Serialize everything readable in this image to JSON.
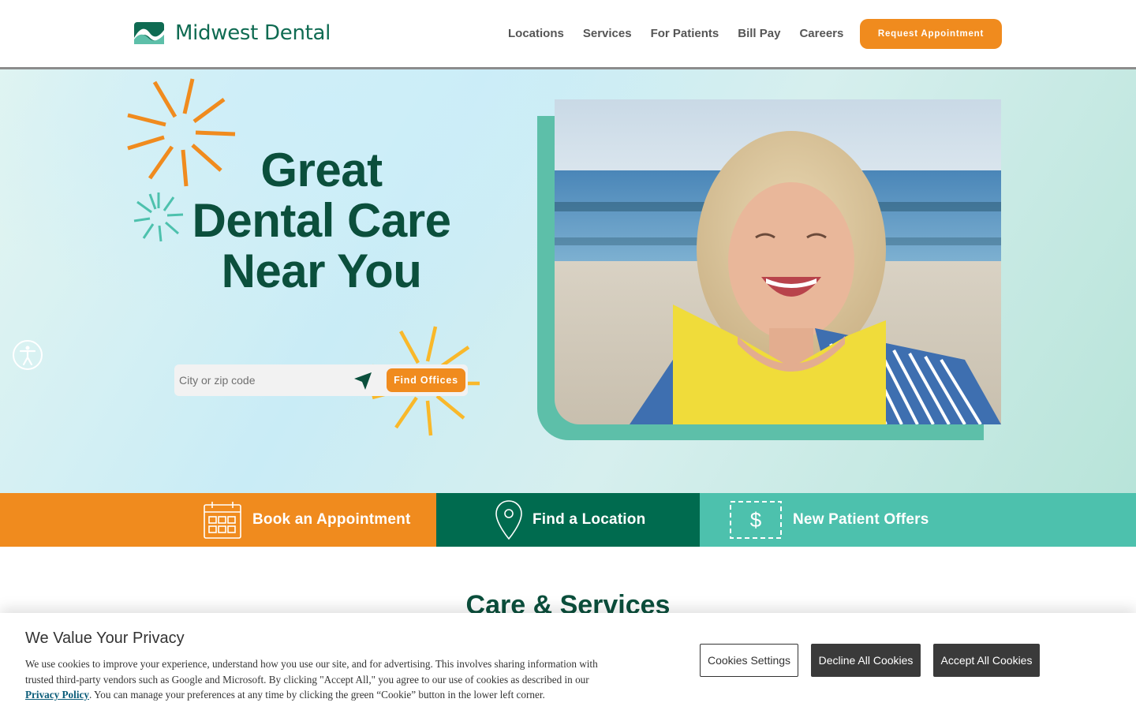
{
  "header": {
    "brand": "Midwest Dental",
    "nav": [
      "Locations",
      "Services",
      "For Patients",
      "Bill Pay",
      "Careers"
    ],
    "cta_label": "Request Appointment"
  },
  "hero": {
    "headline": [
      "Great",
      "Dental Care",
      "Near You"
    ],
    "search_placeholder": "City or zip code",
    "search_button": "Find Offices"
  },
  "cta_strip": {
    "book": "Book an Appointment",
    "find": "Find a Location",
    "offers": "New Patient Offers"
  },
  "section": {
    "title": "Care & Services"
  },
  "cookie": {
    "title": "We Value Your Privacy",
    "text_before": "We use cookies to improve your experience, understand how you use our site, and for advertising. This involves sharing information with trusted third-party vendors such as Google and Microsoft. By clicking \"Accept All,\" you agree to our use of cookies as described in our ",
    "link": "Privacy Policy",
    "text_after": ". You can manage your preferences at any time by clicking the green “Cookie” button in the lower left corner.",
    "settings": "Cookies Settings",
    "decline": "Decline All Cookies",
    "accept": "Accept All Cookies"
  },
  "colors": {
    "brand_green": "#0b4f3c",
    "orange": "#f08b1e",
    "teal": "#4dc1ad",
    "dark_green": "#006b4f"
  },
  "icons": [
    "mountain-logo-icon",
    "sunburst-icon",
    "location-arrow-icon",
    "accessibility-icon",
    "calendar-icon",
    "map-pin-icon",
    "dollar-coupon-icon"
  ]
}
